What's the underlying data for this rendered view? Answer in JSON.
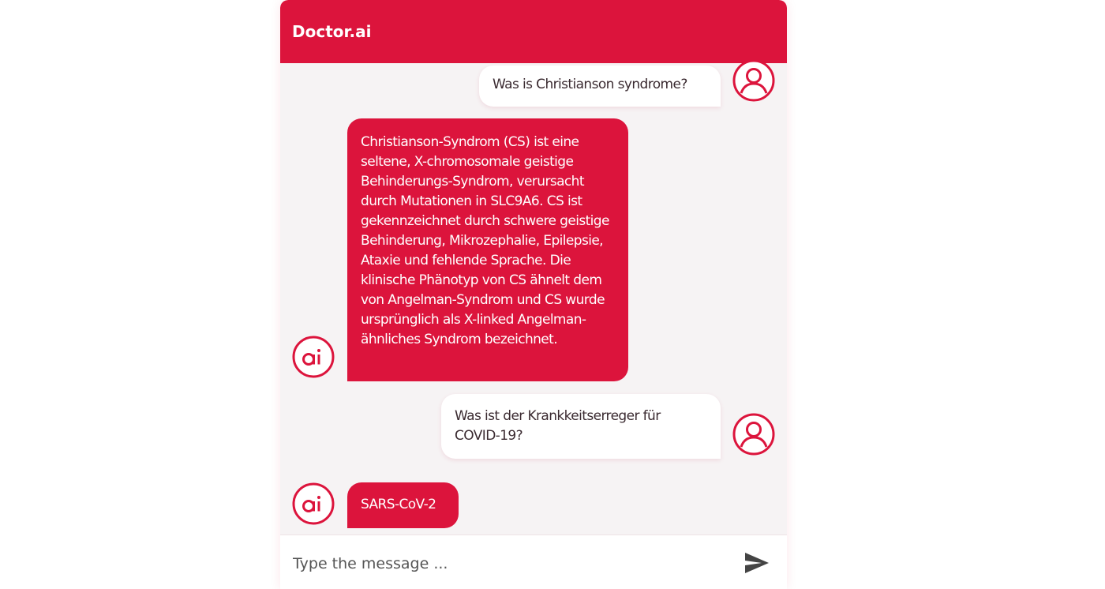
{
  "app": {
    "title": "Doctor.ai"
  },
  "messages": [
    {
      "sender": "user",
      "text": "Was is Christianson syndrome?"
    },
    {
      "sender": "bot",
      "text": "Christianson-Syndrom (CS) ist eine seltene, X-chromosomale geistige Behinderungs-Syndrom, verursacht durch Mutationen in SLC9A6. CS ist gekennzeichnet durch schwere geistige Behinderung, Mikrozephalie, Epilepsie, Ataxie und fehlende Sprache. Die klinische Phänotyp von CS ähnelt dem von Angelman-Syndrom und CS wurde ursprünglich als X-linked Angelman-ähnliches Syndrom bezeichnet."
    },
    {
      "sender": "user",
      "text": "Was ist der Krankkeitserreger für COVID-19?"
    },
    {
      "sender": "bot",
      "text": "SARS-CoV-2"
    }
  ],
  "composer": {
    "placeholder": "Type the message ..."
  },
  "icons": {
    "user_avatar": "user-circle-icon",
    "bot_avatar": "ai-logo-icon",
    "send": "send-icon"
  },
  "colors": {
    "accent": "#dc143c",
    "background": "#f6f3f4",
    "user_bubble": "#ffffff",
    "user_text": "#3a2a30"
  }
}
